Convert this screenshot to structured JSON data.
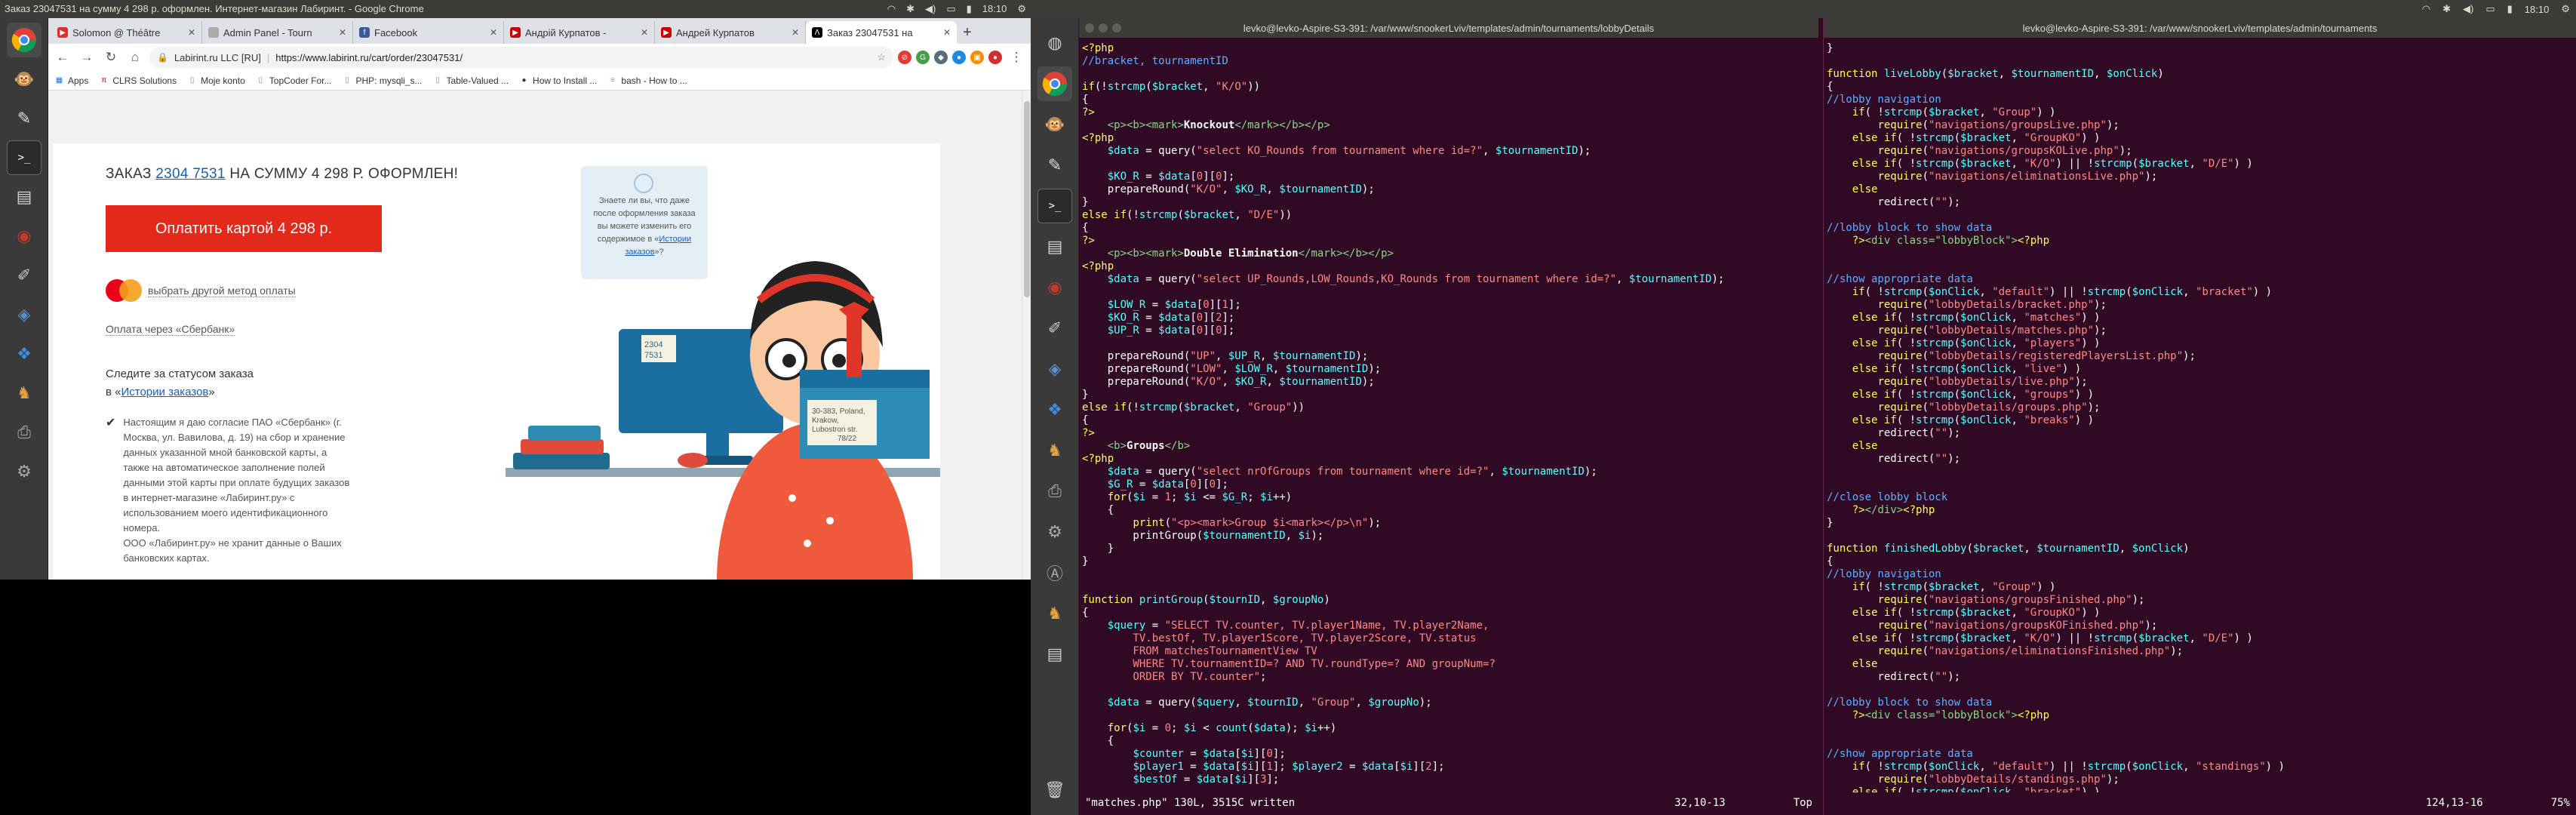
{
  "screen1": {
    "window_title": "Заказ 23047531 на сумму 4 298 р. оформлен. Интернет-магазин Лабиринт. - Google Chrome",
    "time": "18:10",
    "tabs": [
      {
        "label": "Solomon @ Théâtre",
        "color": "#e52d27",
        "icon": "youtube-icon"
      },
      {
        "label": "Admin Panel - Tourn",
        "color": "#1a73e8",
        "icon": "page-icon"
      },
      {
        "label": "Facebook",
        "color": "#3b5998",
        "icon": "facebook-icon"
      },
      {
        "label": "Андрій Курпатов -",
        "color": "#cc0000",
        "icon": "site-icon"
      },
      {
        "label": "Андрей Курпатов",
        "color": "#cc0000",
        "icon": "site-icon"
      },
      {
        "label": "Заказ 23047531 на",
        "color": "#000000",
        "icon": "labirint-icon"
      }
    ],
    "omnibox": {
      "org": "Labirint.ru LLC [RU]",
      "url": "https://www.labirint.ru/cart/order/23047531/"
    },
    "bookmarks": [
      "Apps",
      "CLRS Solutions",
      "Moje konto",
      "TopCoder For...",
      "PHP: mysqli_s...",
      "Table-Valued ...",
      "How to Install ...",
      "bash - How to ..."
    ],
    "order": {
      "prefix": "ЗАКАЗ",
      "number": "2304 7531",
      "suffix": "НА СУММУ 4 298 Р. ОФОРМЛЕН!",
      "pay_button": "Оплатить картой 4 298 р.",
      "other_method": "выбрать другой метод оплаты",
      "sber": "Оплата через «Сбербанк»",
      "track_line1": "Следите за статусом заказа",
      "track_line2_prefix": "в «",
      "track_link": "Истории заказов",
      "track_line2_suffix": "»",
      "consent": "Настоящим я даю согласие ПАО «Сбербанк» (г. Москва, ул. Вавилова, д. 19) на сбор и хранение данных указанной мной банковской карты, а также на автоматическое заполнение полей данными этой карты при оплате будущих заказов в интернет-магазине «Лабиринт.ру» с использованием моего идентификационного номера.",
      "consent2": "ООО «Лабиринт.ру» не хранит данные о Ваших банковских картах."
    },
    "bubble": {
      "text": "Знаете ли вы, что даже после оформления заказа вы можете изменить его содержимое",
      "link_prefix": "в «",
      "link": "Истории заказов",
      "link_suffix": "»?"
    },
    "illustration": {
      "monitor_label_1": "2304",
      "monitor_label_2": "7531",
      "box_label_1": "30-383, Poland,",
      "box_label_2": "Krakow,",
      "box_label_3": "Lubostron str.",
      "box_label_4": "78/22"
    }
  },
  "screen2": {
    "time": "18:10",
    "left_terminal": {
      "title": "levko@levko-Aspire-S3-391: /var/www/snookerLviv/templates/admin/tournaments/lobbyDetails",
      "status_left": "\"matches.php\" 130L, 3515C written",
      "status_mid": "32,10-13",
      "status_right": "Top"
    },
    "right_terminal": {
      "title": "levko@levko-Aspire-S3-391: /var/www/snookerLviv/templates/admin/tournaments",
      "status_mid": "124,13-16",
      "status_right": "75%"
    }
  }
}
